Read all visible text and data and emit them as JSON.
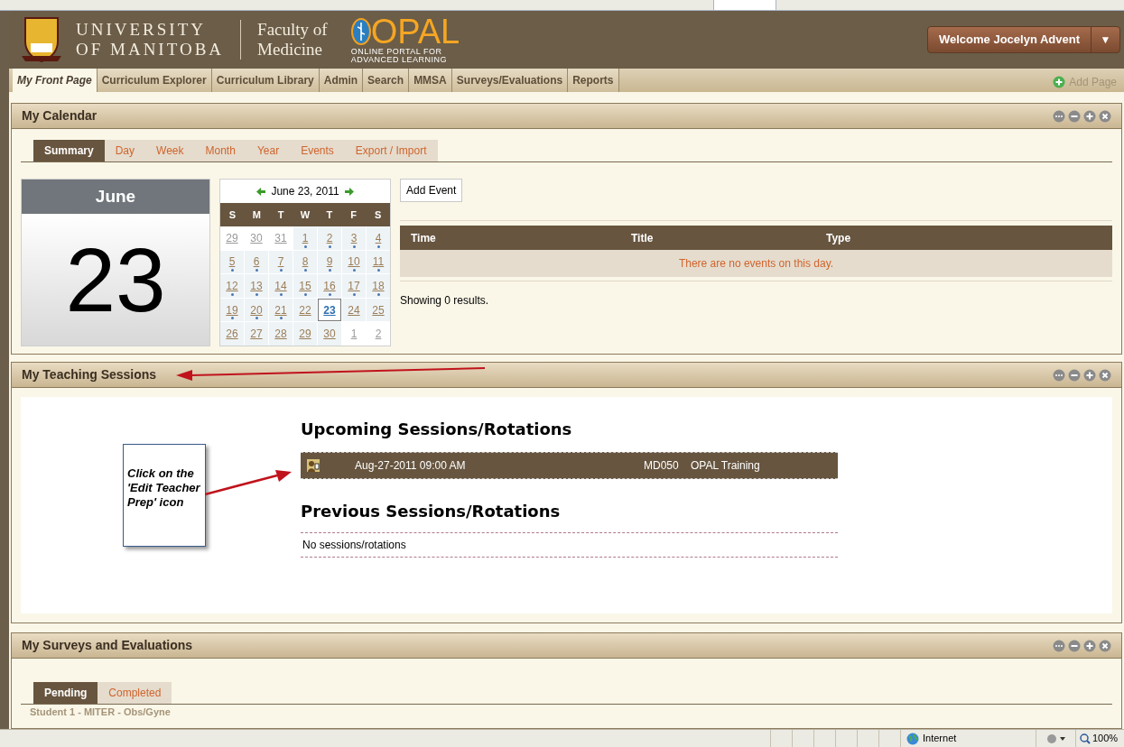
{
  "header": {
    "university": "UNIVERSITY",
    "university_line2": "OF MANITOBA",
    "faculty": "Faculty of",
    "faculty_line2": "Medicine",
    "brand": "OPAL",
    "brand_sub": "ONLINE PORTAL FOR",
    "brand_sub2": "ADVANCED LEARNING",
    "welcome": "Welcome Jocelyn Advent",
    "dropdown": "▼"
  },
  "nav": {
    "tabs": [
      {
        "label": "My Front Page",
        "selected": true
      },
      {
        "label": "Curriculum Explorer",
        "selected": false
      },
      {
        "label": "Curriculum Library",
        "selected": false
      },
      {
        "label": "Admin",
        "selected": false
      },
      {
        "label": "Search",
        "selected": false
      },
      {
        "label": "MMSA",
        "selected": false
      },
      {
        "label": "Surveys/Evaluations",
        "selected": false
      },
      {
        "label": "Reports",
        "selected": false
      }
    ],
    "add_page": "Add Page"
  },
  "calendar_panel": {
    "title": "My Calendar",
    "tabs": [
      {
        "label": "Summary",
        "selected": true
      },
      {
        "label": "Day",
        "selected": false
      },
      {
        "label": "Week",
        "selected": false
      },
      {
        "label": "Month",
        "selected": false
      },
      {
        "label": "Year",
        "selected": false
      },
      {
        "label": "Events",
        "selected": false
      },
      {
        "label": "Export / Import",
        "selected": false
      }
    ],
    "big_month": "June",
    "big_day": "23",
    "mini_title": "June 23, 2011",
    "weekdays": [
      "S",
      "M",
      "T",
      "W",
      "T",
      "F",
      "S"
    ],
    "weeks": [
      [
        {
          "label": "29",
          "outside": true,
          "dot": false,
          "selected": false
        },
        {
          "label": "30",
          "outside": true,
          "dot": false,
          "selected": false
        },
        {
          "label": "31",
          "outside": true,
          "dot": false,
          "selected": false
        },
        {
          "label": "1",
          "outside": false,
          "dot": true,
          "selected": false
        },
        {
          "label": "2",
          "outside": false,
          "dot": true,
          "selected": false
        },
        {
          "label": "3",
          "outside": false,
          "dot": true,
          "selected": false
        },
        {
          "label": "4",
          "outside": false,
          "dot": true,
          "selected": false
        }
      ],
      [
        {
          "label": "5",
          "outside": false,
          "dot": true,
          "selected": false
        },
        {
          "label": "6",
          "outside": false,
          "dot": true,
          "selected": false
        },
        {
          "label": "7",
          "outside": false,
          "dot": true,
          "selected": false
        },
        {
          "label": "8",
          "outside": false,
          "dot": true,
          "selected": false
        },
        {
          "label": "9",
          "outside": false,
          "dot": true,
          "selected": false
        },
        {
          "label": "10",
          "outside": false,
          "dot": true,
          "selected": false
        },
        {
          "label": "11",
          "outside": false,
          "dot": true,
          "selected": false
        }
      ],
      [
        {
          "label": "12",
          "outside": false,
          "dot": true,
          "selected": false
        },
        {
          "label": "13",
          "outside": false,
          "dot": true,
          "selected": false
        },
        {
          "label": "14",
          "outside": false,
          "dot": true,
          "selected": false
        },
        {
          "label": "15",
          "outside": false,
          "dot": true,
          "selected": false
        },
        {
          "label": "16",
          "outside": false,
          "dot": true,
          "selected": false
        },
        {
          "label": "17",
          "outside": false,
          "dot": true,
          "selected": false
        },
        {
          "label": "18",
          "outside": false,
          "dot": true,
          "selected": false
        }
      ],
      [
        {
          "label": "19",
          "outside": false,
          "dot": true,
          "selected": false
        },
        {
          "label": "20",
          "outside": false,
          "dot": true,
          "selected": false
        },
        {
          "label": "21",
          "outside": false,
          "dot": true,
          "selected": false
        },
        {
          "label": "22",
          "outside": false,
          "dot": false,
          "selected": false
        },
        {
          "label": "23",
          "outside": false,
          "dot": false,
          "selected": true
        },
        {
          "label": "24",
          "outside": false,
          "dot": false,
          "selected": false
        },
        {
          "label": "25",
          "outside": false,
          "dot": false,
          "selected": false
        }
      ],
      [
        {
          "label": "26",
          "outside": false,
          "dot": false,
          "selected": false
        },
        {
          "label": "27",
          "outside": false,
          "dot": false,
          "selected": false
        },
        {
          "label": "28",
          "outside": false,
          "dot": false,
          "selected": false
        },
        {
          "label": "29",
          "outside": false,
          "dot": false,
          "selected": false
        },
        {
          "label": "30",
          "outside": false,
          "dot": false,
          "selected": false
        },
        {
          "label": "1",
          "outside": true,
          "dot": false,
          "selected": false
        },
        {
          "label": "2",
          "outside": true,
          "dot": false,
          "selected": false
        }
      ]
    ],
    "add_event": "Add Event",
    "columns": [
      "Time",
      "Title",
      "Type"
    ],
    "empty": "There are no events on this day.",
    "showing": "Showing 0 results."
  },
  "teaching_panel": {
    "title": "My Teaching Sessions",
    "upcoming_heading": "Upcoming Sessions/Rotations",
    "upcoming": [
      {
        "date": "Aug-27-2011 09:00 AM",
        "code": "MD050",
        "name": "OPAL Training"
      }
    ],
    "previous_heading": "Previous Sessions/Rotations",
    "previous_empty": "No sessions/rotations",
    "callout": "Click on the 'Edit Teacher Prep' icon"
  },
  "surveys_panel": {
    "title": "My Surveys and Evaluations",
    "tabs": [
      {
        "label": "Pending",
        "selected": true
      },
      {
        "label": "Completed",
        "selected": false
      }
    ],
    "first_row": "Student 1 - MITER - Obs/Gyne"
  },
  "status_bar": {
    "zone": "Internet",
    "zoom": "100%"
  }
}
